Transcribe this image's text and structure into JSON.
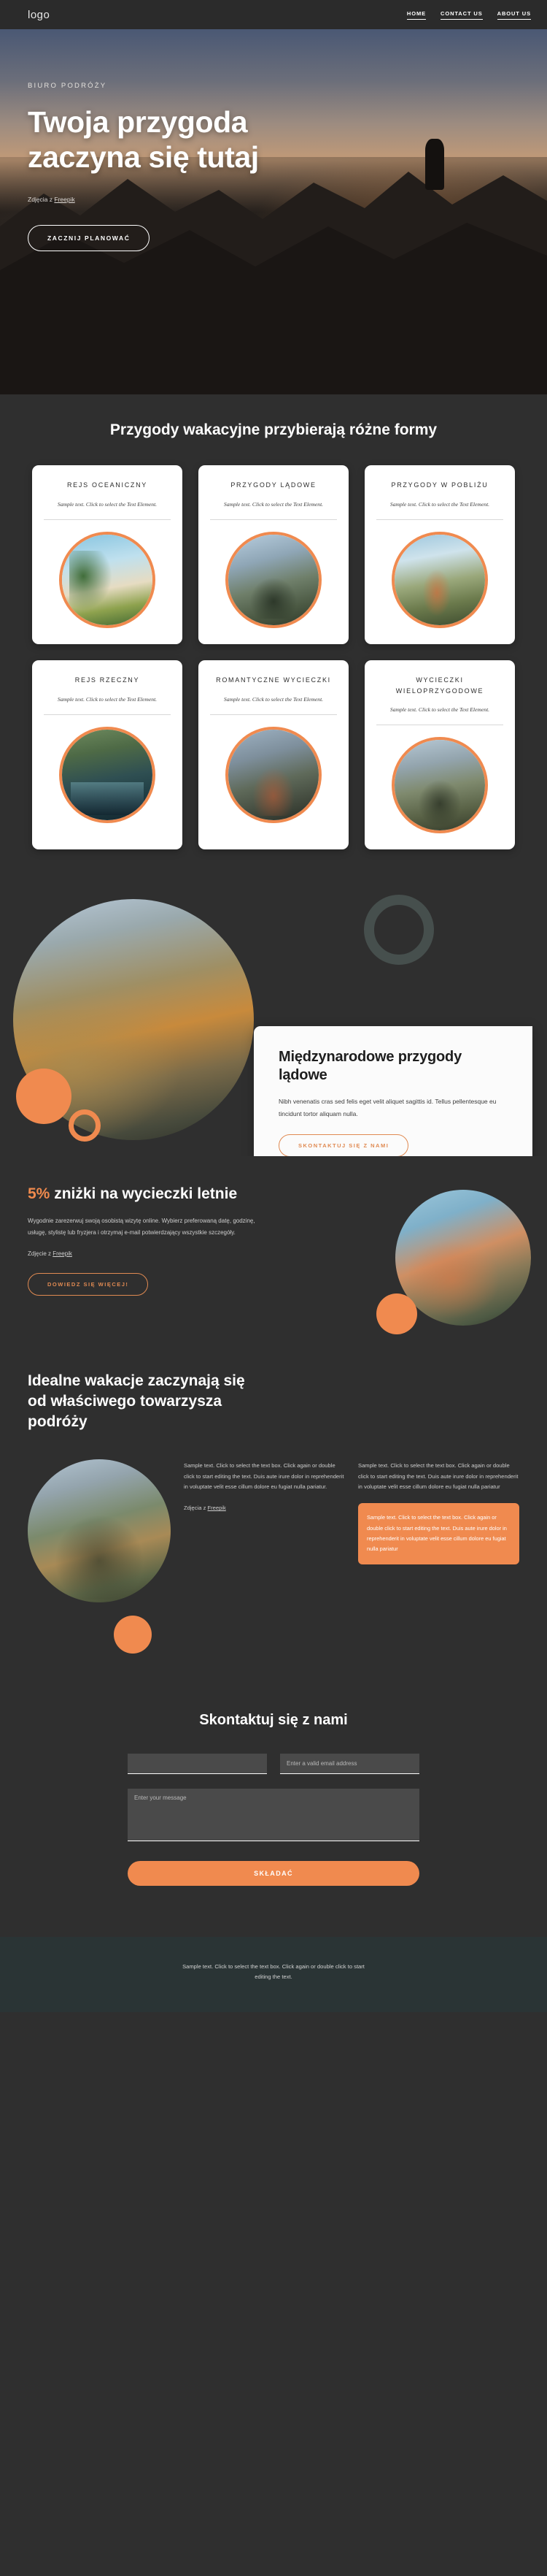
{
  "nav": {
    "logo": "logo",
    "links": [
      {
        "label": "HOME"
      },
      {
        "label": "CONTACT US"
      },
      {
        "label": "ABOUT US"
      }
    ]
  },
  "hero": {
    "eyebrow": "BIURO PODRÓŻY",
    "title": "Twoja przygoda zaczyna się tutaj",
    "credit_prefix": "Zdjęcia z ",
    "credit_link": "Freepik",
    "cta": "ZACZNIJ PLANOWAĆ"
  },
  "cards_section": {
    "heading": "Przygody wakacyjne przybierają różne formy",
    "cards": [
      {
        "title": "REJS OCEANICZNY",
        "sub": "Sample text. Click to select the Text Element.",
        "photo": "ph-beach"
      },
      {
        "title": "PRZYGODY LĄDOWE",
        "sub": "Sample text. Click to select the Text Element.",
        "photo": "ph-hikers"
      },
      {
        "title": "PRZYGODY W POBLIŻU",
        "sub": "Sample text. Click to select the Text Element.",
        "photo": "ph-near"
      },
      {
        "title": "REJS RZECZNY",
        "sub": "Sample text. Click to select the Text Element.",
        "photo": "ph-river"
      },
      {
        "title": "ROMANTYCZNE WYCIECZKI",
        "sub": "Sample text. Click to select the Text Element.",
        "photo": "ph-couple"
      },
      {
        "title": "WYCIECZKI WIELOPRZYGODOWE",
        "sub": "Sample text. Click to select the Text Element.",
        "photo": "ph-bike"
      }
    ]
  },
  "international": {
    "title": "Międzynarodowe przygody lądowe",
    "body": "Nibh venenatis cras sed felis eget velit aliquet sagittis id. Tellus pellentesque eu tincidunt tortor aliquam nulla.",
    "cta": "SKONTAKTUJ SIĘ Z NAMI"
  },
  "discount": {
    "percent": "5%",
    "title_rest": " zniżki na wycieczki letnie",
    "body": "Wygodnie zarezerwuj swoją osobistą wizytę online. Wybierz preferowaną datę, godzinę, usługę, stylistę lub fryzjera i otrzymaj e-mail potwierdzający wszystkie szczegóły.",
    "credit_prefix": "Zdjęcie z ",
    "credit_link": "Freepik",
    "cta": "DOWIEDZ SIĘ WIĘCEJ!"
  },
  "companion": {
    "title": "Idealne wakacje zaczynają się od właściwego towarzysza podróży",
    "col1_text": "Sample text. Click to select the text box. Click again or double click to start editing the text. Duis aute irure dolor in reprehenderit in voluptate velit esse cillum dolore eu fugiat nulla pariatur.",
    "col1_credit_prefix": "Zdjęcia z ",
    "col1_credit_link": "Freepik",
    "col2_text": "Sample text. Click to select the text box. Click again or double click to start editing the text. Duis aute irure dolor in reprehenderit in voluptate velit esse cillum dolore eu fugiat nulla pariatur",
    "box_text": "Sample text. Click to select the text box. Click again or double click to start editing the text. Duis aute irure dolor in reprehenderit in voluptate velit esse cillum dolore eu fugiat nulla pariatur"
  },
  "contact": {
    "title": "Skontaktuj się z nami",
    "name_value": "",
    "name_placeholder": "",
    "email_placeholder": "Enter a valid email address",
    "message_placeholder": "Enter your message",
    "submit": "SKŁADAĆ"
  },
  "footer": {
    "text": "Sample text. Click to select the text box. Click again or double click to start editing the text."
  },
  "colors": {
    "accent": "#f08a4f",
    "bg_dark": "#2f2f2f",
    "nav_bg": "#2b2b2b",
    "footer_bg": "#2a3435",
    "card_bg": "#ffffff"
  }
}
